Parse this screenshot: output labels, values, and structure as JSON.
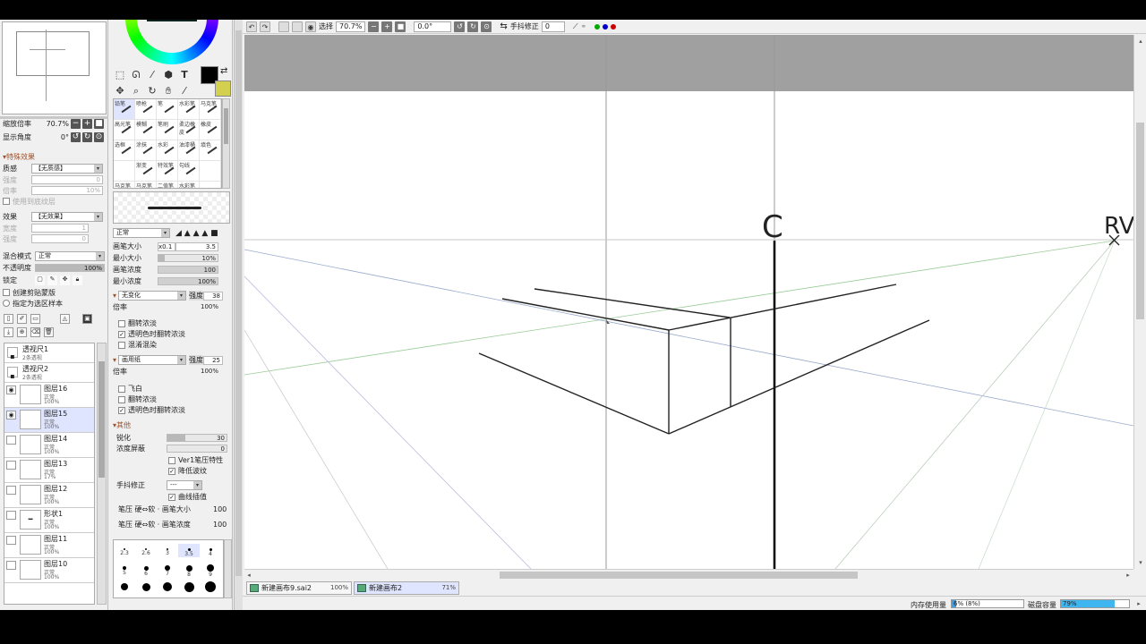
{
  "navigator": {
    "zoom_label": "缩放倍率",
    "zoom_value": "70.7%",
    "angle_label": "显示角度",
    "angle_value": "0°"
  },
  "effects": {
    "title": "特殊效果",
    "texture_label": "质感",
    "texture_value": "【无质感】",
    "scale_label": "倍率",
    "scale_value": "10%",
    "strength_label": "强度",
    "strength_value": "0",
    "apply_texture_label": "使用到底纹层",
    "effect_label": "效果",
    "effect_value": "【无效果】",
    "width_label": "宽度",
    "width_value": "1",
    "strength2_label": "强度",
    "strength2_value": "0"
  },
  "layer_props": {
    "blend_label": "混合模式",
    "blend_value": "正常",
    "opacity_label": "不透明度",
    "opacity_value": "100%",
    "opacity_fraction": 1.0,
    "lock_label": "锁定",
    "clip_label": "创建剪贴蒙版",
    "select_source_label": "指定为选区样本"
  },
  "layers": [
    {
      "name": "透视尺1",
      "mode": "2条透视",
      "opacity": "",
      "type": "ruler",
      "visible": false,
      "selected": false
    },
    {
      "name": "透视尺2",
      "mode": "2条透视",
      "opacity": "",
      "type": "ruler",
      "visible": false,
      "selected": false
    },
    {
      "name": "图层16",
      "mode": "正常",
      "opacity": "100%",
      "type": "layer",
      "visible": true,
      "selected": false
    },
    {
      "name": "图层15",
      "mode": "正常",
      "opacity": "100%",
      "type": "layer",
      "visible": true,
      "selected": true
    },
    {
      "name": "图层14",
      "mode": "正常",
      "opacity": "100%",
      "type": "layer",
      "visible": false,
      "selected": false
    },
    {
      "name": "图层13",
      "mode": "正常",
      "opacity": "17%",
      "type": "layer",
      "visible": false,
      "selected": false
    },
    {
      "name": "图层12",
      "mode": "正常",
      "opacity": "100%",
      "type": "layer",
      "visible": false,
      "selected": false
    },
    {
      "name": "形状1",
      "mode": "正常",
      "opacity": "100%",
      "type": "shape",
      "visible": false,
      "selected": false
    },
    {
      "name": "图层11",
      "mode": "正常",
      "opacity": "100%",
      "type": "layer",
      "visible": false,
      "selected": false
    },
    {
      "name": "图层10",
      "mode": "正常",
      "opacity": "100%",
      "type": "layer",
      "visible": false,
      "selected": false
    }
  ],
  "brushes": [
    {
      "label": "铅笔",
      "selected": true
    },
    {
      "label": "喷枪",
      "selected": false
    },
    {
      "label": "笔",
      "selected": false
    },
    {
      "label": "水彩笔",
      "selected": false
    },
    {
      "label": "马克笔",
      "selected": false
    },
    {
      "label": "高光笔",
      "selected": false
    },
    {
      "label": "模糊",
      "selected": false
    },
    {
      "label": "笔刷",
      "selected": false
    },
    {
      "label": "柔边橡皮",
      "selected": false
    },
    {
      "label": "橡皮",
      "selected": false
    },
    {
      "label": "选框",
      "selected": false
    },
    {
      "label": "涂抹",
      "selected": false
    },
    {
      "label": "水彩",
      "selected": false
    },
    {
      "label": "油漆桶",
      "selected": false
    },
    {
      "label": "填色",
      "selected": false
    },
    {
      "label": "",
      "selected": false
    },
    {
      "label": "渐变",
      "selected": false
    },
    {
      "label": "特效笔",
      "selected": false
    },
    {
      "label": "勾线",
      "selected": false
    },
    {
      "label": "",
      "selected": false
    },
    {
      "label": "马克笔",
      "selected": false
    },
    {
      "label": "马克笔",
      "selected": false
    },
    {
      "label": "二值笔",
      "selected": false
    },
    {
      "label": "水彩笔",
      "selected": false
    },
    {
      "label": "",
      "selected": false
    }
  ],
  "tool_settings": {
    "blend_value": "正常",
    "size_label": "画笔大小",
    "size_mult": "x0.1",
    "size_value": "3.5",
    "min_size_label": "最小大小",
    "min_size_value": "10%",
    "density_label": "画笔浓度",
    "density_value": "100",
    "min_density_label": "最小浓度",
    "min_density_value": "100%",
    "shape_value": "无变化",
    "shape_strength": "38",
    "shape_mag_label": "倍率",
    "shape_mag_value": "100%",
    "cb_invert": "翻转浓淡",
    "cb_invert_tex": "透明色时翻转浓淡",
    "cb_texture": "混淆混染",
    "texture_value": "画用纸",
    "texture_strength": "25",
    "texture_mag_label": "倍率",
    "texture_mag_value": "100%",
    "cb_flyhigh": "飞白",
    "cb_flip": "翻转浓淡",
    "cb_tex_invert": "透明色时翻转浓淡",
    "other_title": "其他",
    "sharp_label": "锐化",
    "sharp_value": "30",
    "pressure_label": "浓度屏蔽",
    "pressure_value": "0",
    "ver1_label": "Ver1笔压特性",
    "lowres_label": "降低波纹",
    "stab_label": "手抖修正",
    "stab_value": "---",
    "curve_label": "曲线插值",
    "ps1_label": "笔压 硬⇔软 · 画笔大小",
    "ps1_value": "100",
    "ps2_label": "笔压 硬⇔软 · 画笔浓度",
    "ps2_value": "100"
  },
  "brush_sizes": [
    "2.3",
    "2.6",
    "3",
    "3.5",
    "4",
    "5",
    "6",
    "7",
    "8",
    "9",
    "",
    "",
    "",
    "",
    ""
  ],
  "toolbar": {
    "select_label": "选择",
    "zoom": "70.7%",
    "angle": "0.0°",
    "stabilizer_label": "手抖修正",
    "stabilizer_value": "0",
    "dot_colors": [
      "#00aa00",
      "#0000cc",
      "#cc0000"
    ]
  },
  "doc_tabs": [
    {
      "name": "新建画布9.sai2",
      "zoom": "100%",
      "active": false
    },
    {
      "name": "新建画布2",
      "zoom": "71%",
      "active": true
    }
  ],
  "status": {
    "memory_label": "内存使用量",
    "memory_value": "6% (8%)",
    "memory_fraction": 0.06,
    "disk_label": "磁盘容量",
    "disk_value": "79%",
    "disk_fraction": 0.79
  },
  "canvas_text": {
    "c_mark": "C",
    "rv_mark": "RV"
  }
}
